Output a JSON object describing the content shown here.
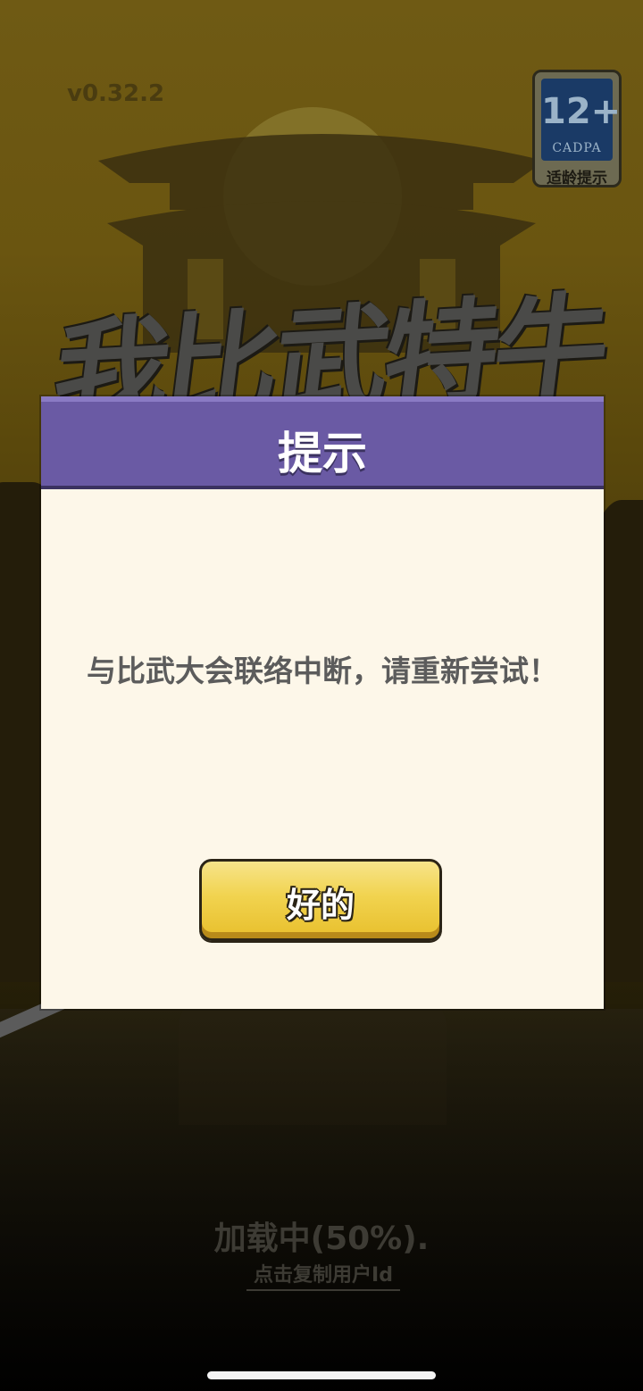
{
  "game": {
    "version": "v0.32.2",
    "title_logo": "我比武特牛"
  },
  "age_rating": {
    "rating": "12+",
    "organization": "CADPA",
    "caption": "适龄提示"
  },
  "dialog": {
    "title": "提示",
    "message": "与比武大会联络中断，请重新尝试！",
    "confirm_label": "好的"
  },
  "loading": {
    "status": "加载中(50%).",
    "copy_user_id": "点击复制用户Id"
  },
  "colors": {
    "dialog_header": "#6a5aa4",
    "dialog_body": "#fdf7e9",
    "button": "#f1d34f"
  }
}
